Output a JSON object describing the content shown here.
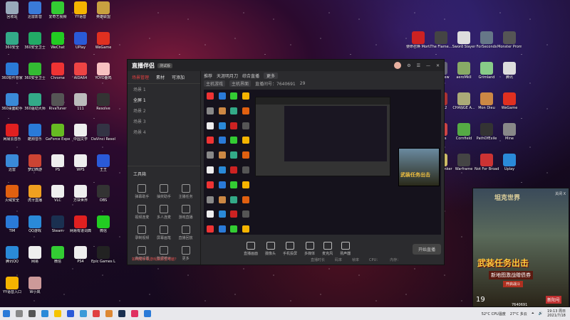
{
  "desktop_left": [
    {
      "label": "回收站",
      "color": "#9ab"
    },
    {
      "label": "迅雷影音",
      "color": "#3a7ad8"
    },
    {
      "label": "爱奇艺视频",
      "color": "#3c3"
    },
    {
      "label": "YY语音",
      "color": "#f5b400"
    },
    {
      "label": "英雄联盟",
      "color": "#c8a040"
    },
    {
      "label": "360安全",
      "color": "#3a8"
    },
    {
      "label": "360安全卫士",
      "color": "#2a6"
    },
    {
      "label": "WeChat",
      "color": "#2c2"
    },
    {
      "label": "UPlay",
      "color": "#2a5ad8"
    },
    {
      "label": "WeGame",
      "color": "#e03020"
    },
    {
      "label": "360软件管家",
      "color": "#2a7ad8"
    },
    {
      "label": "360安全卫士",
      "color": "#3b3"
    },
    {
      "label": "Chrome",
      "color": "#e33"
    },
    {
      "label": "AIDA64",
      "color": "#e44"
    },
    {
      "label": "YOYO鹿鸣",
      "color": "#f8c0c0"
    },
    {
      "label": "360桌面助手",
      "color": "#3a8ad8"
    },
    {
      "label": "360驱动大师",
      "color": "#3a8"
    },
    {
      "label": "RivaTuner",
      "color": "#555"
    },
    {
      "label": "111",
      "color": "#bbb"
    },
    {
      "label": "Resolve",
      "color": "#333"
    },
    {
      "label": "网易云音乐",
      "color": "#e02020"
    },
    {
      "label": "酷狗音乐",
      "color": "#2a7ad8"
    },
    {
      "label": "GeForce Experience",
      "color": "#6b2"
    },
    {
      "label": "中国文学",
      "color": "#eee"
    },
    {
      "label": "DaVinci Resolve",
      "color": "#334"
    },
    {
      "label": "迅雷",
      "color": "#3a8ad8"
    },
    {
      "label": "梦幻西游",
      "color": "#c43"
    },
    {
      "label": "PS",
      "color": "#eee"
    },
    {
      "label": "WPS",
      "color": "#eee"
    },
    {
      "label": "王王",
      "color": "#2a5ad8"
    },
    {
      "label": "火绒安全",
      "color": "#e06010"
    },
    {
      "label": "虎牙直播",
      "color": "#f0a020"
    },
    {
      "label": "VLC",
      "color": "#eee"
    },
    {
      "label": "方块世界",
      "color": "#eee"
    },
    {
      "label": "OBS",
      "color": "#333"
    },
    {
      "label": "TIM",
      "color": "#2a7ad8"
    },
    {
      "label": "QQ游戏",
      "color": "#2a8ad8"
    },
    {
      "label": "Steam",
      "color": "#1a3050"
    },
    {
      "label": "网易有道词典",
      "color": "#e02020"
    },
    {
      "label": "微信",
      "color": "#2c2"
    },
    {
      "label": "腾讯QQ",
      "color": "#2a8ad8"
    },
    {
      "label": "网易",
      "color": "#eee"
    },
    {
      "label": "微信",
      "color": "#3c3"
    },
    {
      "label": "PS4",
      "color": "#eee"
    },
    {
      "label": "Epic Games Launcher",
      "color": "#222"
    },
    {
      "label": "YY语音入口",
      "color": "#f5b400"
    },
    {
      "label": "W小岚",
      "color": "#c99"
    }
  ],
  "desktop_right": [
    {
      "label": "使命召唤 Mortal...",
      "color": "#c22"
    },
    {
      "label": "The Flame...",
      "color": "#444"
    },
    {
      "label": "Sword Slayer",
      "color": "#ddd"
    },
    {
      "label": "ForSeconds",
      "color": "#678"
    },
    {
      "label": "Monster Prom",
      "color": "#555"
    },
    {
      "label": "Steam",
      "color": "#2a5ad8"
    },
    {
      "label": "Lakeview",
      "color": "#667"
    },
    {
      "label": "aeroMkII",
      "color": "#8a6"
    },
    {
      "label": "Grimland",
      "color": "#8c8"
    },
    {
      "label": "腾讯",
      "color": "#ddd"
    },
    {
      "label": "LOL",
      "color": "#c40"
    },
    {
      "label": "Dota 2",
      "color": "#a33"
    },
    {
      "label": "CHANGE A...",
      "color": "#aa7"
    },
    {
      "label": "Mon Dieu",
      "color": "#c84"
    },
    {
      "label": "WeGame",
      "color": "#e03020"
    },
    {
      "label": "Apex",
      "color": "#ddd"
    },
    {
      "label": "Rivals",
      "color": "#c44"
    },
    {
      "label": "Cornfield",
      "color": "#5a4"
    },
    {
      "label": "PathOfExile",
      "color": "#333"
    },
    {
      "label": "Mine",
      "color": "#888"
    },
    {
      "label": "ESO",
      "color": "#777"
    },
    {
      "label": "Mine Bunker",
      "color": "#cb6"
    },
    {
      "label": "Warframe",
      "color": "#444"
    },
    {
      "label": "Not For Broadcast",
      "color": "#c33"
    },
    {
      "label": "Uplay",
      "color": "#2a8ad8"
    },
    {
      "label": "Punch Club",
      "color": "#c22"
    }
  ],
  "obs_window": {
    "logo": "直播伴侣",
    "badge": "测试版",
    "left_tabs": [
      "场景管理",
      "素材",
      "可添加"
    ],
    "scenes": [
      "场景 1",
      "全屏 1",
      "场景 2",
      "场景 3",
      "场景 4"
    ],
    "tools_title": "工具箱",
    "tools": [
      "弹幕助手",
      "抽奖助手",
      "主播任务",
      "视频连麦",
      "多人连麦",
      "游戏直播",
      "录制视频",
      "屏幕画笔",
      "直播回放",
      "高级设置",
      "数据统计",
      "更多"
    ],
    "notice": "如何把手机游戏投屏至电脑？",
    "top_bar": {
      "label": "推荐",
      "category": "天涯明月刀",
      "tags": "综合直播",
      "btn": "更多"
    },
    "sub_bar": {
      "a": "主机游戏",
      "b": "主机界面",
      "room": "直播间号：7640691",
      "viewers": "29"
    },
    "bottom_tools": [
      "直播画面",
      "摄像头",
      "手机投屏",
      "多媒体",
      "麦克风",
      "扬声器"
    ],
    "start_btn": "开始直播",
    "status": [
      "直播时长",
      "码率",
      "帧率",
      "CPU：",
      "内存："
    ]
  },
  "overlay": {
    "title": "坦克世界",
    "close": "关闭 X",
    "main": "武装任务出击",
    "sub": "新地图激战赠债券",
    "btn": "开启战斗",
    "num": "19",
    "id": "7640691",
    "brand": "新阳号"
  },
  "taskbar": {
    "weather": "27°C 多云",
    "cpu": "52°C CPU温度",
    "time": "19:13 周日",
    "date": "2021/7/18"
  }
}
